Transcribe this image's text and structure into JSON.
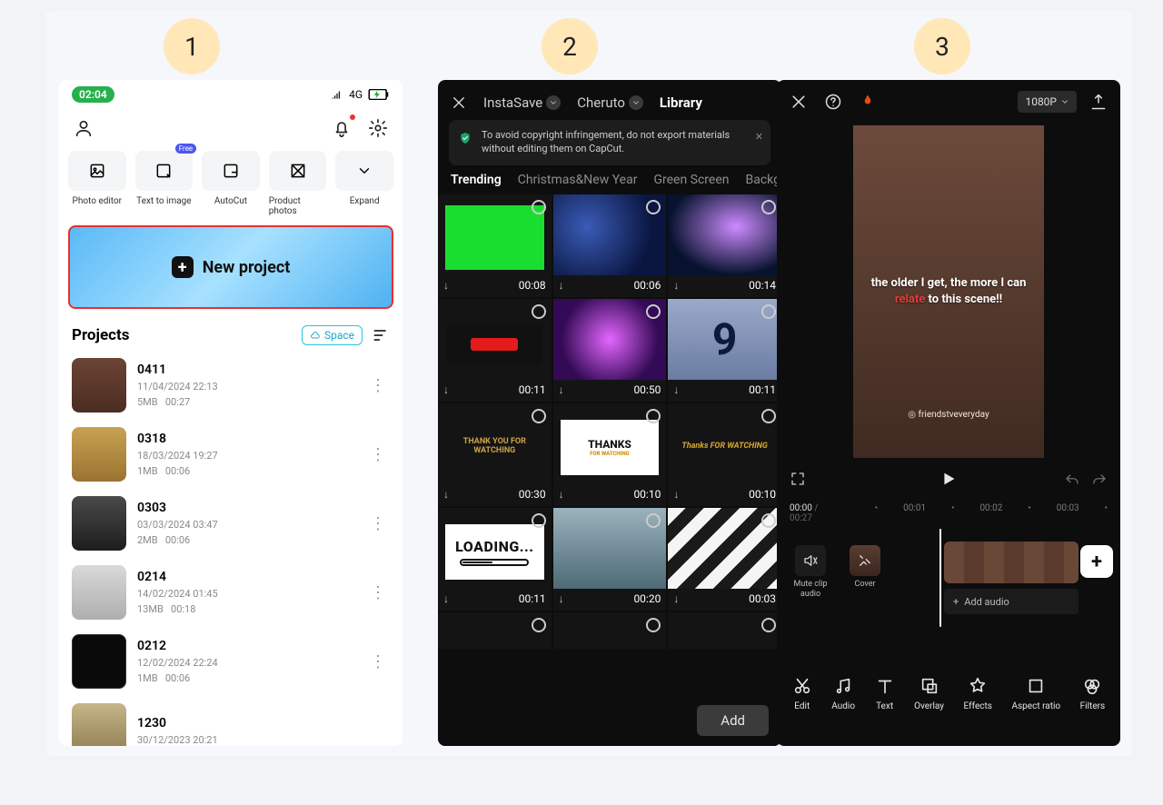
{
  "steps": [
    "1",
    "2",
    "3"
  ],
  "phone1": {
    "time": "02:04",
    "net": "4G",
    "tools": [
      {
        "label": "Photo editor"
      },
      {
        "label": "Text to image",
        "badge": "Free"
      },
      {
        "label": "AutoCut"
      },
      {
        "label": "Product photos"
      },
      {
        "label": "Expand"
      }
    ],
    "new_project": "New project",
    "projects_title": "Projects",
    "space": "Space",
    "projects": [
      {
        "name": "0411",
        "date": "11/04/2024 22:13",
        "size": "5MB",
        "dur": "00:27"
      },
      {
        "name": "0318",
        "date": "18/03/2024 19:27",
        "size": "1MB",
        "dur": "00:06"
      },
      {
        "name": "0303",
        "date": "03/03/2024 03:47",
        "size": "2MB",
        "dur": "00:06"
      },
      {
        "name": "0214",
        "date": "14/02/2024 01:45",
        "size": "13MB",
        "dur": "00:18"
      },
      {
        "name": "0212",
        "date": "12/02/2024 22:24",
        "size": "1MB",
        "dur": "00:06"
      },
      {
        "name": "1230",
        "date": "30/12/2023 20:21",
        "size": "",
        "dur": ""
      }
    ]
  },
  "phone2": {
    "sources": {
      "a": "InstaSave",
      "b": "Cheruto",
      "active": "Library"
    },
    "warning": "To avoid copyright infringement, do not export materials without editing them on CapCut.",
    "categories": [
      "Trending",
      "Christmas&New Year",
      "Green Screen",
      "Backg"
    ],
    "clips": [
      {
        "dur": "00:08"
      },
      {
        "dur": "00:06"
      },
      {
        "dur": "00:14"
      },
      {
        "dur": "00:11"
      },
      {
        "dur": "00:50"
      },
      {
        "dur": "00:11"
      },
      {
        "dur": "00:30"
      },
      {
        "dur": "00:10"
      },
      {
        "dur": "00:10"
      },
      {
        "dur": "00:11"
      },
      {
        "dur": "00:20"
      },
      {
        "dur": "00:03"
      }
    ],
    "thank1": "THANK YOU FOR WATCHING",
    "thank2": "THANKS",
    "thank2_sub": "FOR WATCHING",
    "thank3": "Thanks FOR WATCHING",
    "loading": "LOADING...",
    "count": "9",
    "add": "Add"
  },
  "phone3": {
    "resolution": "1080P",
    "caption_a": "the older I get, the more I can",
    "caption_b": "relate",
    "caption_c": " to this scene!!",
    "tag": "friendstveveryday",
    "time_cur": "00:00",
    "time_total": "00:27",
    "ruler": [
      "00:00",
      "00:01",
      "00:02",
      "00:03"
    ],
    "mute": "Mute clip audio",
    "cover": "Cover",
    "add_audio": "Add audio",
    "tools": [
      "Edit",
      "Audio",
      "Text",
      "Overlay",
      "Effects",
      "Aspect ratio",
      "Filters"
    ]
  }
}
